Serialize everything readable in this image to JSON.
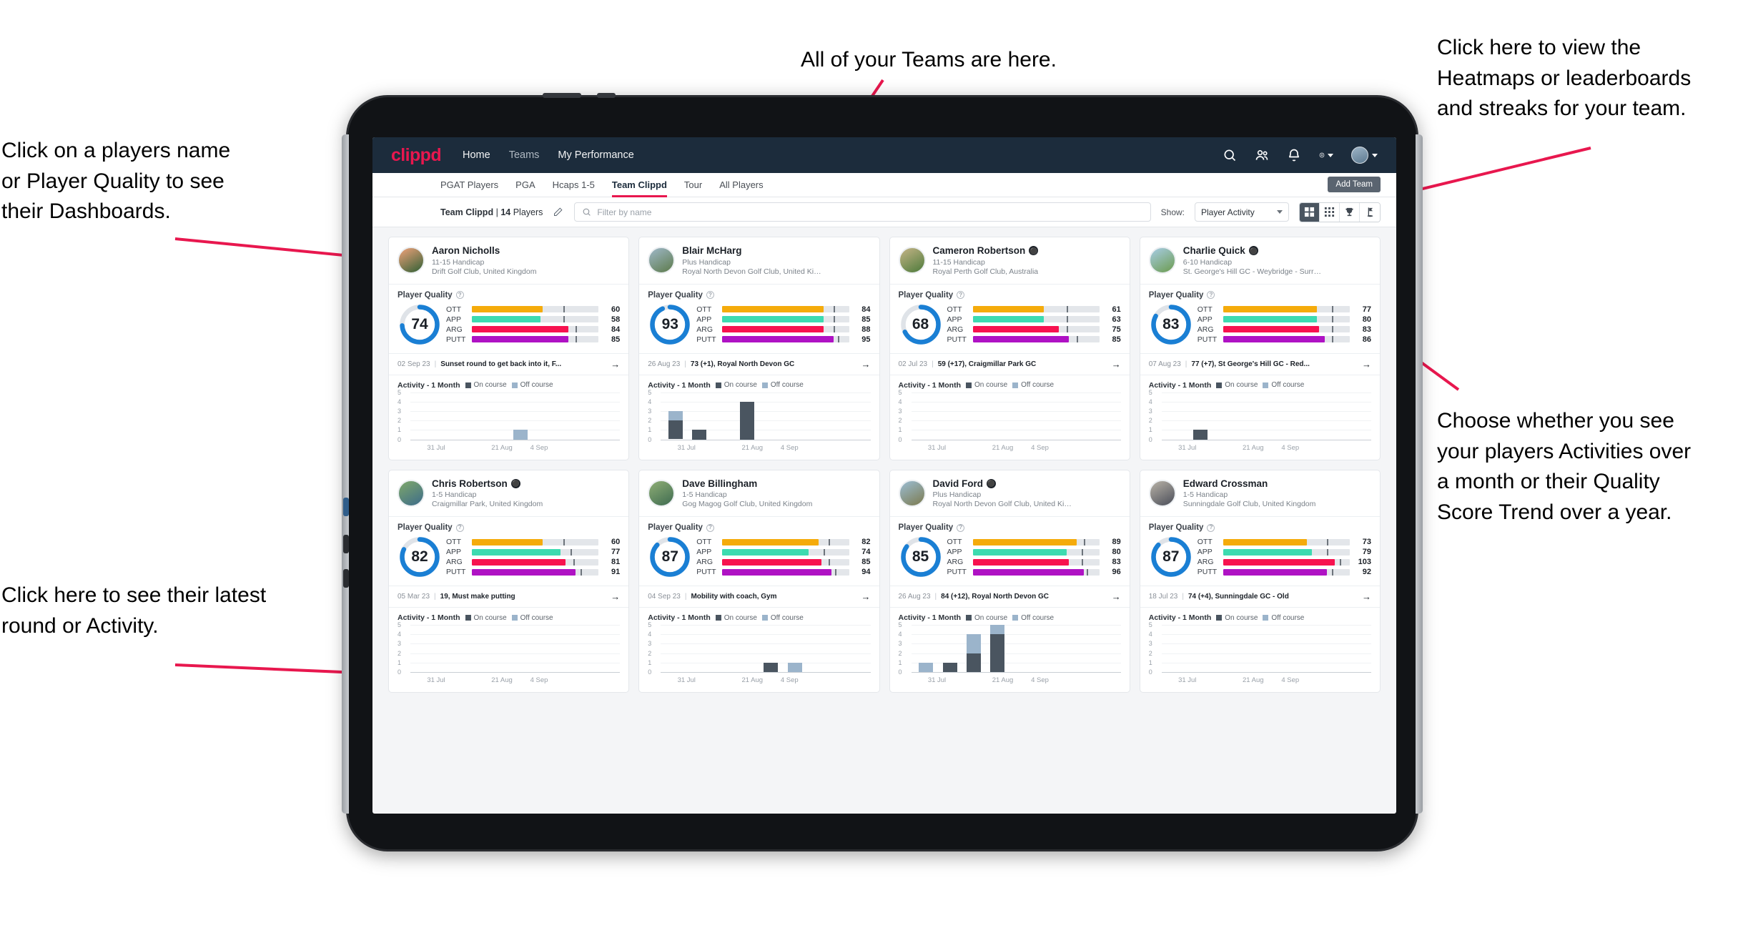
{
  "annotations": {
    "left_top": "Click on a players name\nor Player Quality to see\ntheir Dashboards.",
    "left_bottom": "Click here to see their latest\nround or Activity.",
    "top": "All of your Teams are here.",
    "right_top": "Click here to view the\nHeatmaps or leaderboards\nand streaks for your team.",
    "right_bottom": "Choose whether you see\nyour players Activities over\na month or their Quality\nScore Trend over a year.",
    "color": "#e8174e"
  },
  "navbar": {
    "logo": "clippd",
    "links": [
      {
        "label": "Home",
        "active": true
      },
      {
        "label": "Teams",
        "active": false
      },
      {
        "label": "My Performance",
        "active": false
      }
    ],
    "icons": [
      "search-icon",
      "people-icon",
      "bell-icon",
      "plus-circle-icon",
      "avatar"
    ]
  },
  "tabs": [
    {
      "label": "PGAT Players",
      "active": false
    },
    {
      "label": "PGA",
      "active": false
    },
    {
      "label": "Hcaps 1-5",
      "active": false
    },
    {
      "label": "Team Clippd",
      "active": true
    },
    {
      "label": "Tour",
      "active": false
    },
    {
      "label": "All Players",
      "active": false
    }
  ],
  "add_team_label": "Add Team",
  "toolbar": {
    "team_name": "Team Clippd",
    "team_divider": "|",
    "player_count": "14",
    "players_word": "Players",
    "edit_icon": "pencil-icon",
    "search_placeholder": "Filter by name",
    "search_value": "",
    "show_label": "Show:",
    "show_value": "Player Activity",
    "show_options": [
      "Player Activity",
      "Quality Score Trend"
    ],
    "view_buttons": [
      {
        "name": "grid-view",
        "active": true
      },
      {
        "name": "dots-view",
        "active": false
      },
      {
        "name": "trophy-view",
        "active": false
      },
      {
        "name": "flag-view",
        "active": false
      }
    ]
  },
  "card_labels": {
    "player_quality": "Player Quality",
    "activity_title": "Activity - 1 Month",
    "legend_on": "On course",
    "legend_off": "Off course",
    "y_ticks": [
      "5",
      "4",
      "3",
      "2",
      "1",
      "0"
    ],
    "x_ticks": [
      "31 Jul",
      "21 Aug",
      "4 Sep"
    ]
  },
  "metric_colors": {
    "OTT": "#f5ab0b",
    "APP": "#3ddbb0",
    "ARG": "#f7124f",
    "PUTT": "#af12c4",
    "ring": "#1a7fd4",
    "ring_track": "#dfe3e8"
  },
  "players": [
    {
      "name": "Aaron Nicholls",
      "verified": false,
      "handicap": "11-15 Handicap",
      "club": "Drift Golf Club, United Kingdom",
      "score": 74,
      "avatar_from": "#f0a27a",
      "avatar_to": "#2f5f34",
      "metrics": [
        {
          "label": "OTT",
          "value": 60,
          "fill": 56,
          "tick": 72
        },
        {
          "label": "APP",
          "value": 58,
          "fill": 54,
          "tick": 72
        },
        {
          "label": "ARG",
          "value": 84,
          "fill": 76,
          "tick": 82
        },
        {
          "label": "PUTT",
          "value": 85,
          "fill": 76,
          "tick": 82
        }
      ],
      "round_date": "02 Sep 23",
      "round_text": "Sunset round to get back into it, F...",
      "chart_data": {
        "type": "bar",
        "title": "Activity - 1 Month",
        "series": [
          {
            "name": "On course",
            "values": [
              0,
              0,
              0,
              0,
              0,
              0
            ]
          },
          {
            "name": "Off course",
            "values": [
              0,
              0,
              0,
              0,
              1,
              0
            ]
          }
        ],
        "ylim": [
          0,
          5
        ],
        "x_ticks": [
          "31 Jul",
          "21 Aug",
          "4 Sep"
        ]
      }
    },
    {
      "name": "Blair McHarg",
      "verified": false,
      "handicap": "Plus Handicap",
      "club": "Royal North Devon Golf Club, United Kin...",
      "score": 93,
      "avatar_from": "#9fb8c9",
      "avatar_to": "#5c7a4a",
      "metrics": [
        {
          "label": "OTT",
          "value": 84,
          "fill": 80,
          "tick": 88
        },
        {
          "label": "APP",
          "value": 85,
          "fill": 80,
          "tick": 88
        },
        {
          "label": "ARG",
          "value": 88,
          "fill": 80,
          "tick": 88
        },
        {
          "label": "PUTT",
          "value": 95,
          "fill": 88,
          "tick": 91
        }
      ],
      "round_date": "26 Aug 23",
      "round_text": "73 (+1), Royal North Devon GC",
      "chart_data": {
        "type": "bar",
        "title": "Activity - 1 Month",
        "series": [
          {
            "name": "On course",
            "values": [
              2,
              1,
              0,
              4,
              0,
              0
            ]
          },
          {
            "name": "Off course",
            "values": [
              1,
              0,
              0,
              0,
              0,
              0
            ]
          }
        ],
        "ylim": [
          0,
          5
        ],
        "x_ticks": [
          "31 Jul",
          "21 Aug",
          "4 Sep"
        ]
      }
    },
    {
      "name": "Cameron Robertson",
      "verified": true,
      "handicap": "11-15 Handicap",
      "club": "Royal Perth Golf Club, Australia",
      "score": 68,
      "avatar_from": "#c5b487",
      "avatar_to": "#4c7a3a",
      "metrics": [
        {
          "label": "OTT",
          "value": 61,
          "fill": 56,
          "tick": 74
        },
        {
          "label": "APP",
          "value": 63,
          "fill": 56,
          "tick": 74
        },
        {
          "label": "ARG",
          "value": 75,
          "fill": 68,
          "tick": 74
        },
        {
          "label": "PUTT",
          "value": 85,
          "fill": 76,
          "tick": 82
        }
      ],
      "round_date": "02 Jul 23",
      "round_text": "59 (+17), Craigmillar Park GC",
      "chart_data": {
        "type": "bar",
        "title": "Activity - 1 Month",
        "series": [
          {
            "name": "On course",
            "values": [
              0,
              0,
              0,
              0,
              0,
              0
            ]
          },
          {
            "name": "Off course",
            "values": [
              0,
              0,
              0,
              0,
              0,
              0
            ]
          }
        ],
        "ylim": [
          0,
          5
        ],
        "x_ticks": [
          "31 Jul",
          "21 Aug",
          "4 Sep"
        ]
      }
    },
    {
      "name": "Charlie Quick",
      "verified": true,
      "handicap": "6-10 Handicap",
      "club": "St. George's Hill GC - Weybridge - Surrey, ...",
      "score": 83,
      "avatar_from": "#a8cde6",
      "avatar_to": "#6b9b4e",
      "metrics": [
        {
          "label": "OTT",
          "value": 77,
          "fill": 74,
          "tick": 86
        },
        {
          "label": "APP",
          "value": 80,
          "fill": 74,
          "tick": 86
        },
        {
          "label": "ARG",
          "value": 83,
          "fill": 76,
          "tick": 86
        },
        {
          "label": "PUTT",
          "value": 86,
          "fill": 80,
          "tick": 86
        }
      ],
      "round_date": "07 Aug 23",
      "round_text": "77 (+7), St George's Hill GC - Red...",
      "chart_data": {
        "type": "bar",
        "title": "Activity - 1 Month",
        "series": [
          {
            "name": "On course",
            "values": [
              0,
              1,
              0,
              0,
              0,
              0
            ]
          },
          {
            "name": "Off course",
            "values": [
              0,
              0,
              0,
              0,
              0,
              0
            ]
          }
        ],
        "ylim": [
          0,
          5
        ],
        "x_ticks": [
          "31 Jul",
          "21 Aug",
          "4 Sep"
        ]
      }
    },
    {
      "name": "Chris Robertson",
      "verified": true,
      "handicap": "1-5 Handicap",
      "club": "Craigmillar Park, United Kingdom",
      "score": 82,
      "avatar_from": "#7fa86a",
      "avatar_to": "#3c6b8a",
      "metrics": [
        {
          "label": "OTT",
          "value": 60,
          "fill": 56,
          "tick": 72
        },
        {
          "label": "APP",
          "value": 77,
          "fill": 70,
          "tick": 78
        },
        {
          "label": "ARG",
          "value": 81,
          "fill": 74,
          "tick": 80
        },
        {
          "label": "PUTT",
          "value": 91,
          "fill": 82,
          "tick": 86
        }
      ],
      "round_date": "05 Mar 23",
      "round_text": "19, Must make putting",
      "chart_data": {
        "type": "bar",
        "title": "Activity - 1 Month",
        "series": [
          {
            "name": "On course",
            "values": [
              0,
              0,
              0,
              0,
              0,
              0
            ]
          },
          {
            "name": "Off course",
            "values": [
              0,
              0,
              0,
              0,
              0,
              0
            ]
          }
        ],
        "ylim": [
          0,
          5
        ],
        "x_ticks": [
          "31 Jul",
          "21 Aug",
          "4 Sep"
        ]
      }
    },
    {
      "name": "Dave Billingham",
      "verified": false,
      "handicap": "1-5 Handicap",
      "club": "Gog Magog Golf Club, United Kingdom",
      "score": 87,
      "avatar_from": "#8fae76",
      "avatar_to": "#3e6b50",
      "metrics": [
        {
          "label": "OTT",
          "value": 82,
          "fill": 76,
          "tick": 84
        },
        {
          "label": "APP",
          "value": 74,
          "fill": 68,
          "tick": 80
        },
        {
          "label": "ARG",
          "value": 85,
          "fill": 78,
          "tick": 84
        },
        {
          "label": "PUTT",
          "value": 94,
          "fill": 86,
          "tick": 89
        }
      ],
      "round_date": "04 Sep 23",
      "round_text": "Mobility with coach, Gym",
      "chart_data": {
        "type": "bar",
        "title": "Activity - 1 Month",
        "series": [
          {
            "name": "On course",
            "values": [
              0,
              0,
              0,
              0,
              1,
              0
            ]
          },
          {
            "name": "Off course",
            "values": [
              0,
              0,
              0,
              0,
              0,
              1
            ]
          }
        ],
        "ylim": [
          0,
          5
        ],
        "x_ticks": [
          "31 Jul",
          "21 Aug",
          "4 Sep"
        ]
      }
    },
    {
      "name": "David Ford",
      "verified": true,
      "handicap": "Plus Handicap",
      "club": "Royal North Devon Golf Club, United Kin...",
      "score": 85,
      "avatar_from": "#9bbdd4",
      "avatar_to": "#7c7a4e",
      "metrics": [
        {
          "label": "OTT",
          "value": 89,
          "fill": 82,
          "tick": 88
        },
        {
          "label": "APP",
          "value": 80,
          "fill": 74,
          "tick": 86
        },
        {
          "label": "ARG",
          "value": 83,
          "fill": 76,
          "tick": 86
        },
        {
          "label": "PUTT",
          "value": 96,
          "fill": 88,
          "tick": 90
        }
      ],
      "round_date": "26 Aug 23",
      "round_text": "84 (+12), Royal North Devon GC",
      "chart_data": {
        "type": "bar",
        "title": "Activity - 1 Month",
        "series": [
          {
            "name": "On course",
            "values": [
              0,
              1,
              2,
              4,
              0,
              0
            ]
          },
          {
            "name": "Off course",
            "values": [
              1,
              0,
              2,
              1,
              0,
              0
            ]
          }
        ],
        "ylim": [
          0,
          5
        ],
        "x_ticks": [
          "31 Jul",
          "21 Aug",
          "4 Sep"
        ]
      }
    },
    {
      "name": "Edward Crossman",
      "verified": false,
      "handicap": "1-5 Handicap",
      "club": "Sunningdale Golf Club, United Kingdom",
      "score": 87,
      "avatar_from": "#b9b3a8",
      "avatar_to": "#4a4d58",
      "metrics": [
        {
          "label": "OTT",
          "value": 73,
          "fill": 66,
          "tick": 82
        },
        {
          "label": "APP",
          "value": 79,
          "fill": 70,
          "tick": 82
        },
        {
          "label": "ARG",
          "value": 103,
          "fill": 88,
          "tick": 92
        },
        {
          "label": "PUTT",
          "value": 92,
          "fill": 82,
          "tick": 86
        }
      ],
      "round_date": "18 Jul 23",
      "round_text": "74 (+4), Sunningdale GC - Old",
      "chart_data": {
        "type": "bar",
        "title": "Activity - 1 Month",
        "series": [
          {
            "name": "On course",
            "values": [
              0,
              0,
              0,
              0,
              0,
              0
            ]
          },
          {
            "name": "Off course",
            "values": [
              0,
              0,
              0,
              0,
              0,
              0
            ]
          }
        ],
        "ylim": [
          0,
          5
        ],
        "x_ticks": [
          "31 Jul",
          "21 Aug",
          "4 Sep"
        ]
      }
    }
  ]
}
